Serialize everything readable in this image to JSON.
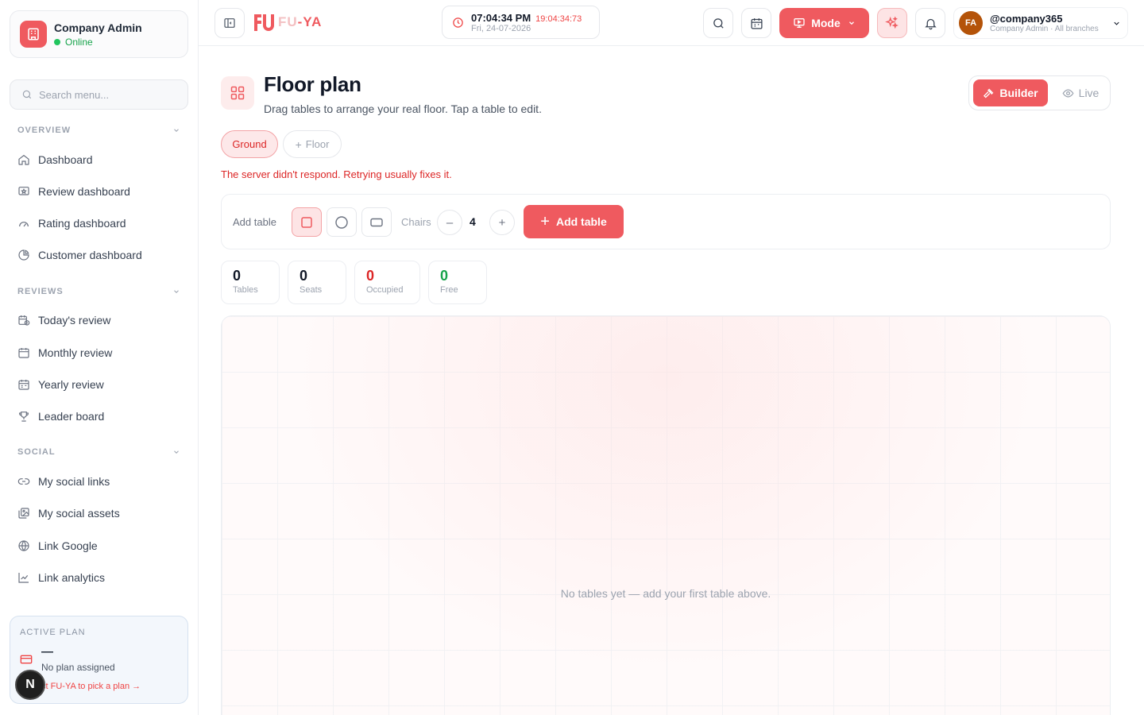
{
  "sidebar": {
    "company": "Company Admin",
    "status": "Online",
    "search_placeholder": "Search menu...",
    "sections": {
      "overview": "OVERVIEW",
      "reviews": "REVIEWS",
      "social": "SOCIAL"
    },
    "overview_items": [
      {
        "label": "Dashboard",
        "icon": "home-icon"
      },
      {
        "label": "Review dashboard",
        "icon": "review-icon"
      },
      {
        "label": "Rating dashboard",
        "icon": "gauge-icon"
      },
      {
        "label": "Customer dashboard",
        "icon": "pie-icon"
      }
    ],
    "review_items": [
      {
        "label": "Today's review",
        "icon": "calendar-clock-icon"
      },
      {
        "label": "Monthly review",
        "icon": "calendar-icon"
      },
      {
        "label": "Yearly review",
        "icon": "calendar-icon"
      },
      {
        "label": "Leader board",
        "icon": "trophy-icon"
      }
    ],
    "social_items": [
      {
        "label": "My social links",
        "icon": "link-icon"
      },
      {
        "label": "My social assets",
        "icon": "image-icon"
      },
      {
        "label": "Link Google",
        "icon": "globe-icon"
      },
      {
        "label": "Link analytics",
        "icon": "chart-icon"
      }
    ],
    "plan": {
      "label": "ACTIVE PLAN",
      "name": "—",
      "status": "No plan assigned",
      "link": "ct FU-YA to pick a plan →"
    },
    "badge": "N"
  },
  "topbar": {
    "logo_prefix": "FU",
    "logo_suffix": "-YA",
    "time": "07:04:34 PM",
    "time_alt": "19:04:34:73",
    "date": "Fri, 24-07-2026",
    "mode_label": "Mode",
    "user_initials": "FA",
    "user_name": "@company365",
    "user_role": "Company Admin · All branches"
  },
  "page": {
    "title": "Floor plan",
    "subtitle": "Drag tables to arrange your real floor. Tap a table to edit.",
    "builder_label": "Builder",
    "live_label": "Live",
    "floors": [
      "Ground"
    ],
    "add_floor_label": "Floor",
    "error": "The server didn't respond. Retrying usually fixes it.",
    "toolbar": {
      "add_table_label": "Add table",
      "chairs_label": "Chairs",
      "chairs_value": "4",
      "add_button": "Add table"
    },
    "stats": [
      {
        "value": "0",
        "label": "Tables",
        "color": "#111827"
      },
      {
        "value": "0",
        "label": "Seats",
        "color": "#111827"
      },
      {
        "value": "0",
        "label": "Occupied",
        "color": "#dc2626"
      },
      {
        "value": "0",
        "label": "Free",
        "color": "#16a34a"
      }
    ],
    "empty": "No tables yet — add your first table above."
  },
  "colors": {
    "accent": "#ef5a5f",
    "success": "#22c55e",
    "error": "#dc2626"
  }
}
